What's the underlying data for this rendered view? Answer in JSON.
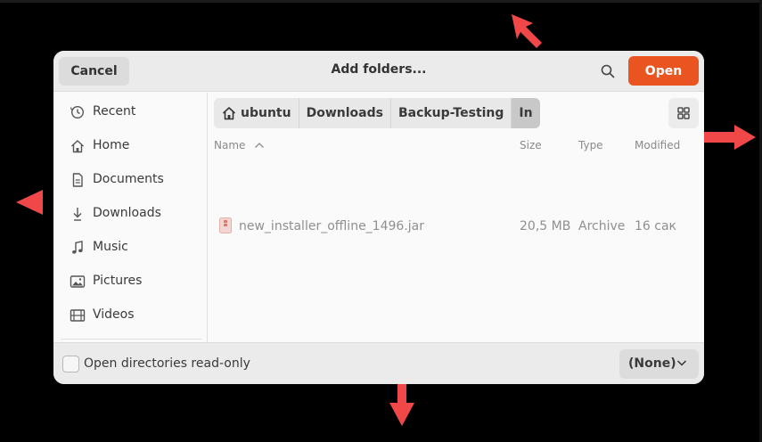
{
  "dialog": {
    "title": "Add folders...",
    "cancel_label": "Cancel",
    "open_label": "Open",
    "accent_color": "#e95420"
  },
  "sidebar": {
    "items": [
      {
        "label": "Recent",
        "icon": "clock-icon"
      },
      {
        "label": "Home",
        "icon": "home-icon"
      },
      {
        "label": "Documents",
        "icon": "document-icon"
      },
      {
        "label": "Downloads",
        "icon": "download-icon"
      },
      {
        "label": "Music",
        "icon": "music-icon"
      },
      {
        "label": "Pictures",
        "icon": "picture-icon"
      },
      {
        "label": "Videos",
        "icon": "video-icon"
      }
    ]
  },
  "breadcrumb": {
    "items": [
      "ubuntu",
      "Downloads",
      "Backup-Testing",
      "In"
    ]
  },
  "table": {
    "headers": {
      "name": "Name",
      "size": "Size",
      "type": "Type",
      "modified": "Modified"
    },
    "rows": [
      {
        "name": "new_installer_offline_1496.jar",
        "size": "20,5 MB",
        "type": "Archive",
        "modified": "16 сак"
      }
    ]
  },
  "footer": {
    "readonly_label": "Open directories read-only",
    "filter_value": "(None)"
  },
  "annotation_color": "#f04848"
}
